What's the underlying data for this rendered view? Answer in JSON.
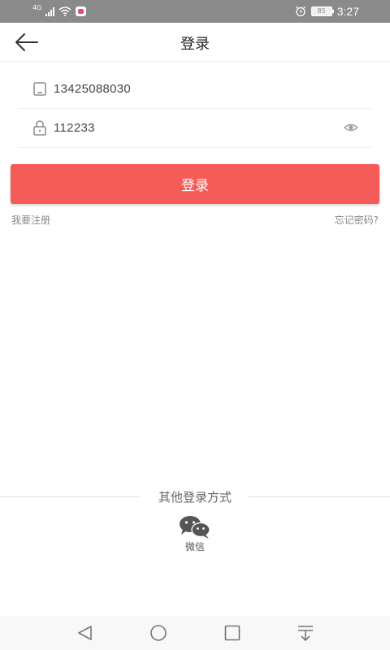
{
  "status_bar": {
    "network_type": "4G",
    "battery": "85",
    "time": "3:27"
  },
  "header": {
    "title": "登录",
    "back_icon": "arrow-left-icon"
  },
  "form": {
    "phone_value": "13425088030",
    "password_value": "112233",
    "phone_icon": "phone-icon",
    "lock_icon": "lock-icon",
    "eye_icon": "eye-icon"
  },
  "login_button_label": "登录",
  "links": {
    "register": "我要注册",
    "forgot_password": "忘记密码?"
  },
  "other_login": {
    "title": "其他登录方式",
    "wechat_label": "微信",
    "wechat_icon": "wechat-icon"
  },
  "nav_bar": {
    "icons": [
      "back-triangle-icon",
      "home-circle-icon",
      "recents-square-icon",
      "notification-pulldown-icon"
    ]
  },
  "colors": {
    "accent": "#f65c57",
    "status_bar": "#8a8a8a"
  }
}
